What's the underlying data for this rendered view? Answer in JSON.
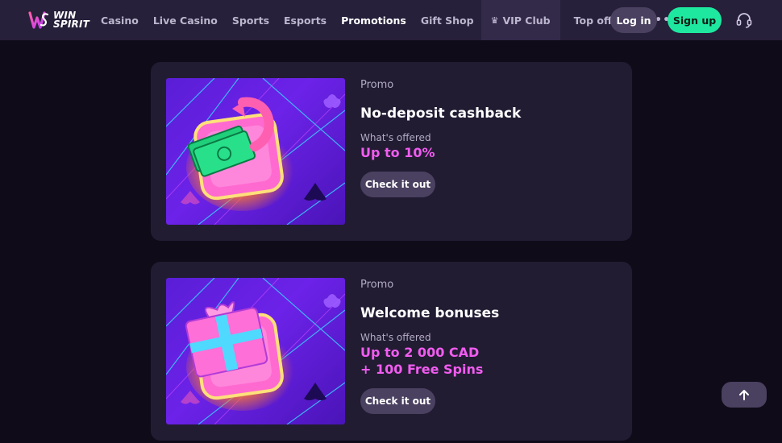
{
  "brand": {
    "logo_text_line1": "WIN",
    "logo_text_line2": "SPIRIT"
  },
  "nav": {
    "items": [
      {
        "label": "Casino"
      },
      {
        "label": "Live Casino"
      },
      {
        "label": "Sports"
      },
      {
        "label": "Esports"
      },
      {
        "label": "Promotions",
        "active": true
      },
      {
        "label": "Gift Shop"
      },
      {
        "label": "VIP Club",
        "icon": "crown-icon"
      },
      {
        "label": "Top offers"
      }
    ],
    "more_icon": "more-dots-icon"
  },
  "header": {
    "login_label": "Log in",
    "signup_label": "Sign up",
    "support_icon": "headset-icon"
  },
  "colors": {
    "accent_green": "#1ee8a0",
    "offer_pink": "#f15cf0",
    "card_bg": "#221c33",
    "header_bg": "#27203a"
  },
  "promos": [
    {
      "label": "Promo",
      "title": "No-deposit cashback",
      "offer_label": "What's offered",
      "offer_line1": "Up to 10%",
      "offer_line2": "",
      "cta": "Check it out",
      "image_icon": "cashback-money-icon"
    },
    {
      "label": "Promo",
      "title": "Welcome bonuses",
      "offer_label": "What's offered",
      "offer_line1": "Up to 2 000 CAD",
      "offer_line2": "+ 100 Free Spins",
      "cta": "Check it out",
      "image_icon": "gift-box-icon"
    }
  ],
  "scroll_top_icon": "arrow-up-icon"
}
